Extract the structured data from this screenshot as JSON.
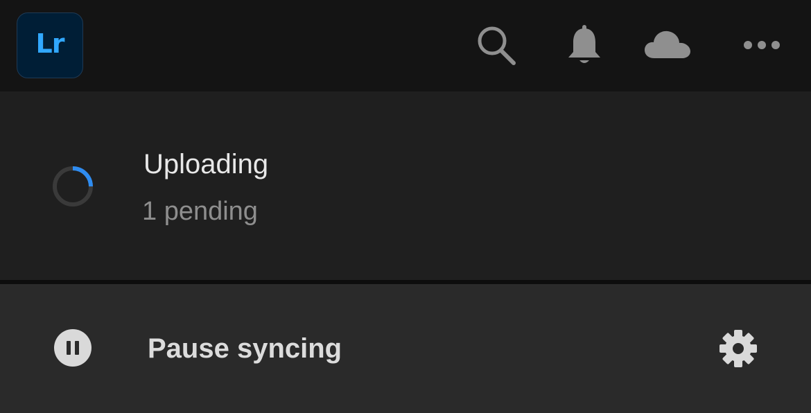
{
  "app": {
    "logo_text": "Lr"
  },
  "toolbar": {
    "icons": [
      "search-icon",
      "bell-icon",
      "cloud-icon",
      "more-icon"
    ]
  },
  "upload": {
    "title": "Uploading",
    "status": "1 pending"
  },
  "sync": {
    "pause_label": "Pause syncing"
  },
  "colors": {
    "accent": "#2f8cf0",
    "logo_bg": "#001e36",
    "logo_text": "#31a8ff"
  }
}
